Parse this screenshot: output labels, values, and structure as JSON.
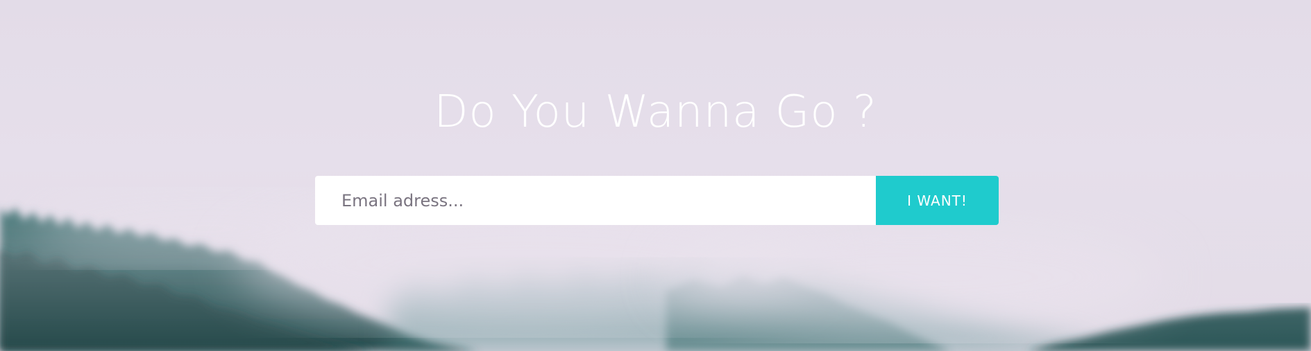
{
  "hero": {
    "headline": "Do You Wanna Go ?",
    "background_image": "misty-forest-hillside",
    "colors": {
      "sky": "#e4dde9",
      "forest_dark": "#1e4d4e",
      "forest_mid": "#3b7373",
      "fog": "#ebe4ee"
    }
  },
  "signup_form": {
    "email_placeholder": "Email adress...",
    "email_value": "",
    "submit_label": "I WANT!",
    "accent_color": "#1fcbcd"
  }
}
